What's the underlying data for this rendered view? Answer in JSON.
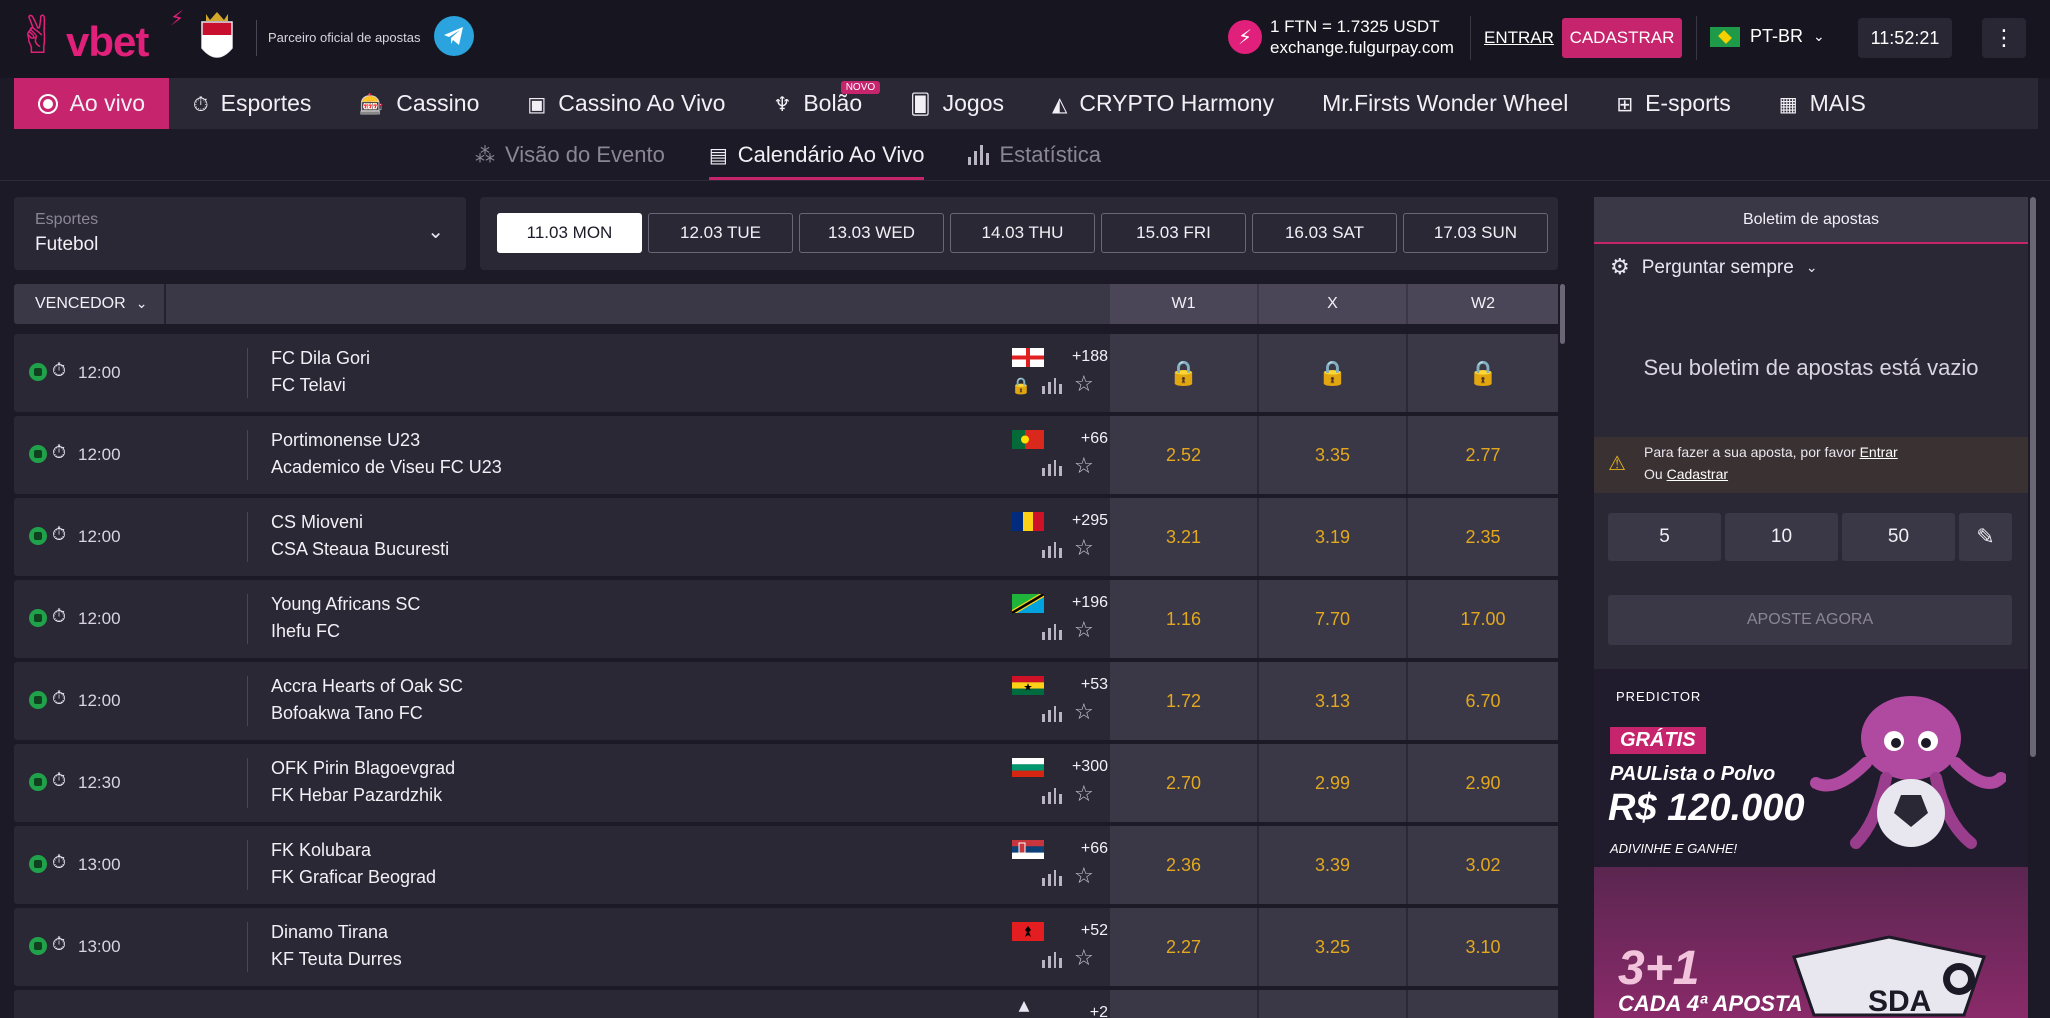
{
  "header": {
    "brand": "vbet",
    "partner_text": "Parceiro oficial de apostas",
    "exchange_rate": "1 FTN = 1.7325 USDT",
    "exchange_site": "exchange.fulgurpay.com",
    "login_label": "ENTRAR",
    "register_label": "CADASTRAR",
    "language": "PT-BR",
    "time": "11:52:21",
    "colors": {
      "brand": "#e0207a",
      "accent": "#c6246d",
      "odds": "#e3a81c"
    }
  },
  "nav": {
    "items": [
      {
        "label": "Ao vivo",
        "icon": "live-dot-icon"
      },
      {
        "label": "Esportes",
        "icon": "stopwatch-icon"
      },
      {
        "label": "Cassino",
        "icon": "slot-machine-icon"
      },
      {
        "label": "Cassino Ao Vivo",
        "icon": "live-casino-icon"
      },
      {
        "label": "Bolão",
        "icon": "octopus-icon",
        "badge": "NOVO"
      },
      {
        "label": "Jogos",
        "icon": "cards-icon"
      },
      {
        "label": "CRYPTO Harmony",
        "icon": "crypto-icon"
      },
      {
        "label": "Mr.Firsts Wonder Wheel",
        "icon": ""
      },
      {
        "label": "E-sports",
        "icon": "esports-icon"
      },
      {
        "label": "MAIS",
        "icon": "grid-icon"
      }
    ]
  },
  "subnav": {
    "items": [
      {
        "label": "Visão do Evento"
      },
      {
        "label": "Calendário Ao Vivo"
      },
      {
        "label": "Estatística"
      }
    ]
  },
  "sport_select": {
    "label": "Esportes",
    "value": "Futebol"
  },
  "dates": [
    "11.03 MON",
    "12.03 TUE",
    "13.03 WED",
    "14.03 THU",
    "15.03 FRI",
    "16.03 SAT",
    "17.03 SUN"
  ],
  "table": {
    "market_label": "VENCEDOR",
    "columns": [
      "W1",
      "X",
      "W2"
    ],
    "rows": [
      {
        "time": "12:00",
        "team1": "FC Dila Gori",
        "team2": "FC Telavi",
        "flag": "georgia",
        "more": "+188",
        "locked": true,
        "odds": [
          "",
          "",
          ""
        ]
      },
      {
        "time": "12:00",
        "team1": "Portimonense U23",
        "team2": "Academico de Viseu FC U23",
        "flag": "portugal",
        "more": "+66",
        "locked": false,
        "odds": [
          "2.52",
          "3.35",
          "2.77"
        ]
      },
      {
        "time": "12:00",
        "team1": "CS Mioveni",
        "team2": "CSA Steaua Bucuresti",
        "flag": "romania",
        "more": "+295",
        "locked": false,
        "odds": [
          "3.21",
          "3.19",
          "2.35"
        ]
      },
      {
        "time": "12:00",
        "team1": "Young Africans SC",
        "team2": "Ihefu FC",
        "flag": "tanzania",
        "more": "+196",
        "locked": false,
        "odds": [
          "1.16",
          "7.70",
          "17.00"
        ]
      },
      {
        "time": "12:00",
        "team1": "Accra Hearts of Oak SC",
        "team2": "Bofoakwa Tano FC",
        "flag": "ghana",
        "more": "+53",
        "locked": false,
        "odds": [
          "1.72",
          "3.13",
          "6.70"
        ]
      },
      {
        "time": "12:30",
        "team1": "OFK Pirin Blagoevgrad",
        "team2": "FK Hebar Pazardzhik",
        "flag": "bulgaria",
        "more": "+300",
        "locked": false,
        "odds": [
          "2.70",
          "2.99",
          "2.90"
        ]
      },
      {
        "time": "13:00",
        "team1": "FK Kolubara",
        "team2": "FK Graficar Beograd",
        "flag": "serbia",
        "more": "+66",
        "locked": false,
        "odds": [
          "2.36",
          "3.39",
          "3.02"
        ]
      },
      {
        "time": "13:00",
        "team1": "Dinamo Tirana",
        "team2": "KF Teuta Durres",
        "flag": "albania",
        "more": "+52",
        "locked": false,
        "odds": [
          "2.27",
          "3.25",
          "3.10"
        ]
      },
      {
        "time": "",
        "team1": "",
        "team2": "",
        "flag": "",
        "more": "+2",
        "locked": false,
        "odds": [
          "",
          "",
          ""
        ]
      }
    ]
  },
  "betslip": {
    "title": "Boletim de apostas",
    "ask_mode": "Perguntar sempre",
    "empty_text": "Seu boletim de apostas está vazio",
    "warning_prefix": "Para fazer a sua aposta, por favor",
    "warning_login": "Entrar",
    "warning_or": "Ou",
    "warning_register": "Cadastrar",
    "stakes": [
      "5",
      "10",
      "50"
    ],
    "place_label": "APOSTE AGORA"
  },
  "promo1": {
    "brand": "PREDICTOR",
    "badge": "GRÁTIS",
    "headline": "PAULista o Polvo",
    "amount": "R$ 120.000",
    "cta": "ADIVINHE E GANHE!"
  },
  "promo2": {
    "headline": "3+1",
    "subline": "CADA 4ª APOSTA",
    "watermark": "SDA"
  }
}
